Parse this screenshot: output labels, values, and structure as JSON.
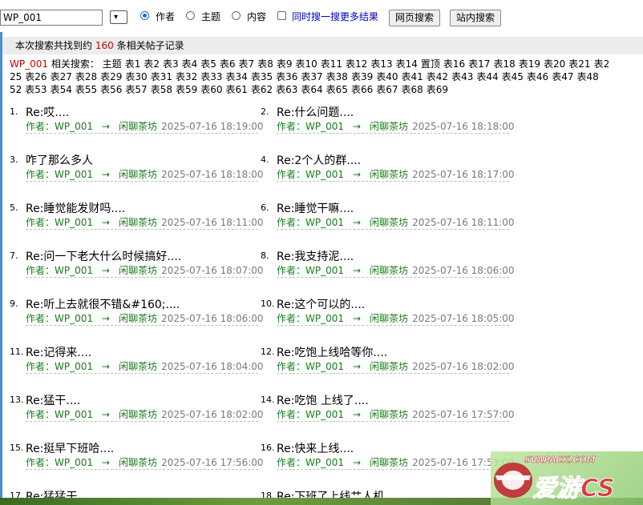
{
  "search": {
    "query_value": "WP_001",
    "options": [
      "作者",
      "主题",
      "内容"
    ],
    "selected_option": "作者",
    "more_results_label": "同时搜一搜更多结果",
    "web_search_button": "网页搜索",
    "site_search_button": "站内搜索"
  },
  "summary": {
    "prefix": "本次搜索共找到约",
    "count": "160",
    "suffix": "条相关帖子记录"
  },
  "related": {
    "keyword": "WP_001",
    "label": "相关搜索：",
    "line1": [
      "主题",
      "表1",
      "表2",
      "表3",
      "表4",
      "表5",
      "表6",
      "表7",
      "表8",
      "表9",
      "表10",
      "表11",
      "表12",
      "表13",
      "表14",
      "置顶",
      "表16",
      "表17",
      "表18",
      "表19",
      "表20",
      "表21",
      "表2"
    ],
    "line2": [
      "25",
      "表26",
      "表27",
      "表28",
      "表29",
      "表30",
      "表31",
      "表32",
      "表33",
      "表34",
      "表35",
      "表36",
      "表37",
      "表38",
      "表39",
      "表40",
      "表41",
      "表42",
      "表43",
      "表44",
      "表45",
      "表46",
      "表47",
      "表48"
    ],
    "line3": [
      "52",
      "表53",
      "表54",
      "表55",
      "表56",
      "表57",
      "表58",
      "表59",
      "表60",
      "表61",
      "表62",
      "表63",
      "表64",
      "表65",
      "表66",
      "表67",
      "表68",
      "表69"
    ]
  },
  "meta_common": {
    "author_label": "作者：",
    "author": "WP_001",
    "arrow": "→",
    "forum": "闲聊茶坊"
  },
  "posts": [
    {
      "num": "1.",
      "title": "Re:哎....",
      "time": "2025-07-16 18:19:00"
    },
    {
      "num": "2.",
      "title": "Re:什么问题....",
      "time": "2025-07-16 18:18:00"
    },
    {
      "num": "3.",
      "title": "咋了那么多人",
      "time": "2025-07-16 18:18:00"
    },
    {
      "num": "4.",
      "title": "Re:2个人的群....",
      "time": "2025-07-16 18:17:00"
    },
    {
      "num": "5.",
      "title": "Re:睡觉能发财吗....",
      "time": "2025-07-16 18:11:00"
    },
    {
      "num": "6.",
      "title": "Re:睡觉干嘛....",
      "time": "2025-07-16 18:11:00"
    },
    {
      "num": "7.",
      "title": "Re:问一下老大什么时候搞好....",
      "time": "2025-07-16 18:07:00"
    },
    {
      "num": "8.",
      "title": "Re:我支持泥....",
      "time": "2025-07-16 18:06:00"
    },
    {
      "num": "9.",
      "title": "Re:听上去就很不错&#160;....",
      "time": "2025-07-16 18:06:00"
    },
    {
      "num": "10.",
      "title": "Re:这个可以的....",
      "time": "2025-07-16 18:05:00"
    },
    {
      "num": "11.",
      "title": "Re:记得来....",
      "time": "2025-07-16 18:04:00"
    },
    {
      "num": "12.",
      "title": "Re:吃饱上线哈等你....",
      "time": "2025-07-16 18:02:00"
    },
    {
      "num": "13.",
      "title": "Re:猛干....",
      "time": "2025-07-16 18:02:00"
    },
    {
      "num": "14.",
      "title": "Re:吃饱 上线了....",
      "time": "2025-07-16 17:57:00"
    },
    {
      "num": "15.",
      "title": "Re:挺早下班哈....",
      "time": "2025-07-16 17:56:00"
    },
    {
      "num": "16.",
      "title": "Re:快来上线....",
      "time": "2025-07-16 17:53:00"
    },
    {
      "num": "17.",
      "title": "Re:猛猛干",
      "time": ""
    },
    {
      "num": "18.",
      "title": "Re:下班了上线艹人机",
      "time": ""
    }
  ],
  "watermark": {
    "text_top": "SVAPACK.COM",
    "text_main": "爱游CS"
  },
  "colors": {
    "accent_blue": "#4a8fd4",
    "count_red": "#cc0000",
    "meta_green": "#1a7a1a",
    "time_gray": "#7a7a7a",
    "link_blue": "#0000cc"
  }
}
